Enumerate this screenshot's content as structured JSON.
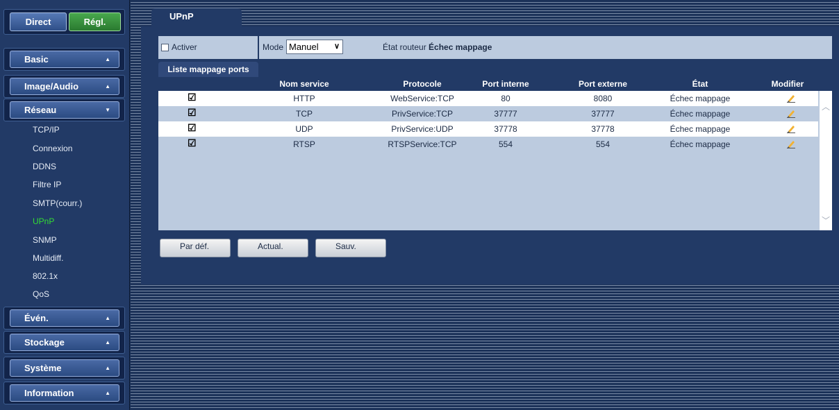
{
  "top_buttons": {
    "direct": "Direct",
    "regl": "Régl."
  },
  "sidebar": {
    "basic": "Basic",
    "image_audio": "Image/Audio",
    "reseau": "Réseau",
    "reseau_items": [
      "TCP/IP",
      "Connexion",
      "DDNS",
      "Filtre IP",
      "SMTP(courr.)",
      "UPnP",
      "SNMP",
      "Multidiff.",
      "802.1x",
      "QoS"
    ],
    "reseau_active": "UPnP",
    "even": "Évén.",
    "stockage": "Stockage",
    "systeme": "Système",
    "information": "Information"
  },
  "page": {
    "tab": "UPnP",
    "activer_label": "Activer",
    "activer_checked": false,
    "mode_label": "Mode",
    "mode_value": "Manuel",
    "etat_routeur_label": "État routeur",
    "etat_routeur_value": "Échec mappage",
    "list_tab": "Liste mappage ports"
  },
  "table": {
    "headers": [
      "Nom service",
      "Protocole",
      "Port interne",
      "Port externe",
      "État",
      "Modifier"
    ],
    "rows": [
      {
        "checked": true,
        "service": "HTTP",
        "protocole": "WebService:TCP",
        "interne": "80",
        "externe": "8080",
        "etat": "Échec mappage"
      },
      {
        "checked": true,
        "service": "TCP",
        "protocole": "PrivService:TCP",
        "interne": "37777",
        "externe": "37777",
        "etat": "Échec mappage"
      },
      {
        "checked": true,
        "service": "UDP",
        "protocole": "PrivService:UDP",
        "interne": "37778",
        "externe": "37778",
        "etat": "Échec mappage"
      },
      {
        "checked": true,
        "service": "RTSP",
        "protocole": "RTSPService:TCP",
        "interne": "554",
        "externe": "554",
        "etat": "Échec mappage"
      }
    ]
  },
  "buttons": {
    "default": "Par déf.",
    "refresh": "Actual.",
    "save": "Sauv."
  },
  "colors": {
    "active_green": "#33dd33",
    "nav_blue": "#223a66",
    "row_blue": "#bccbdf"
  },
  "icons": {
    "edit": "pencil-icon",
    "expand": "chevron-up-icon",
    "collapse": "chevron-down-icon"
  }
}
